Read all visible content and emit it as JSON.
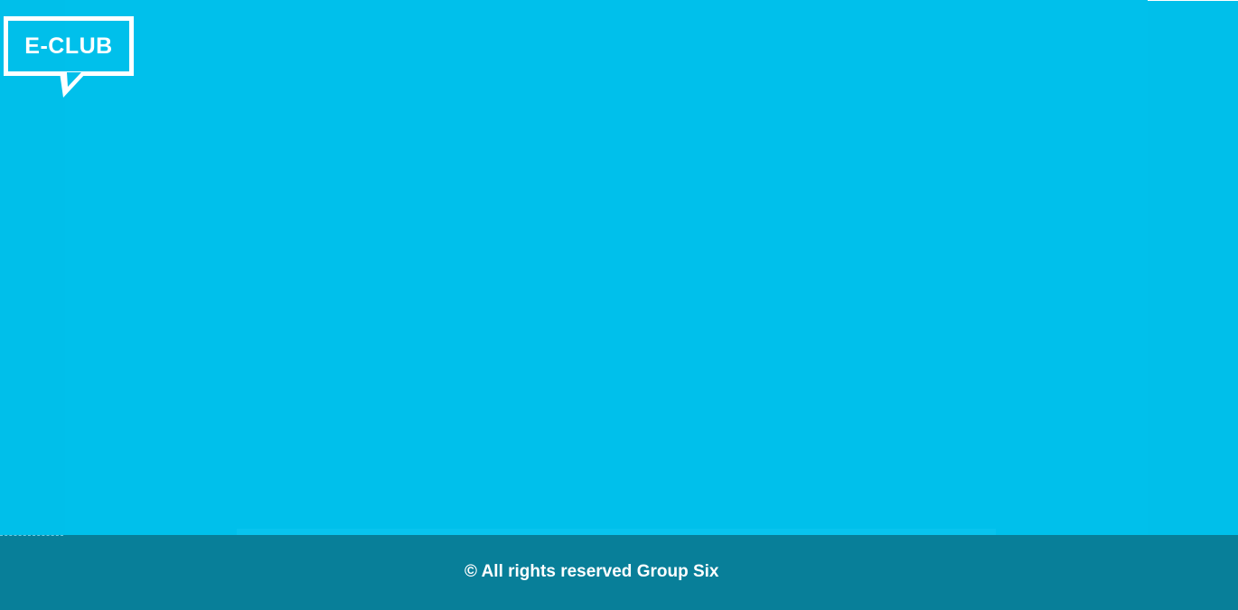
{
  "brand": {
    "logo_text": "E-CLUB"
  },
  "footer": {
    "copyright": "© All rights reserved Group Six"
  },
  "colors": {
    "background": "#00bfea",
    "footer": "#087f99",
    "logo": "#ffffff",
    "footer_text": "#ffffff"
  },
  "icons": {
    "logo": "speech-bubble-icon"
  }
}
